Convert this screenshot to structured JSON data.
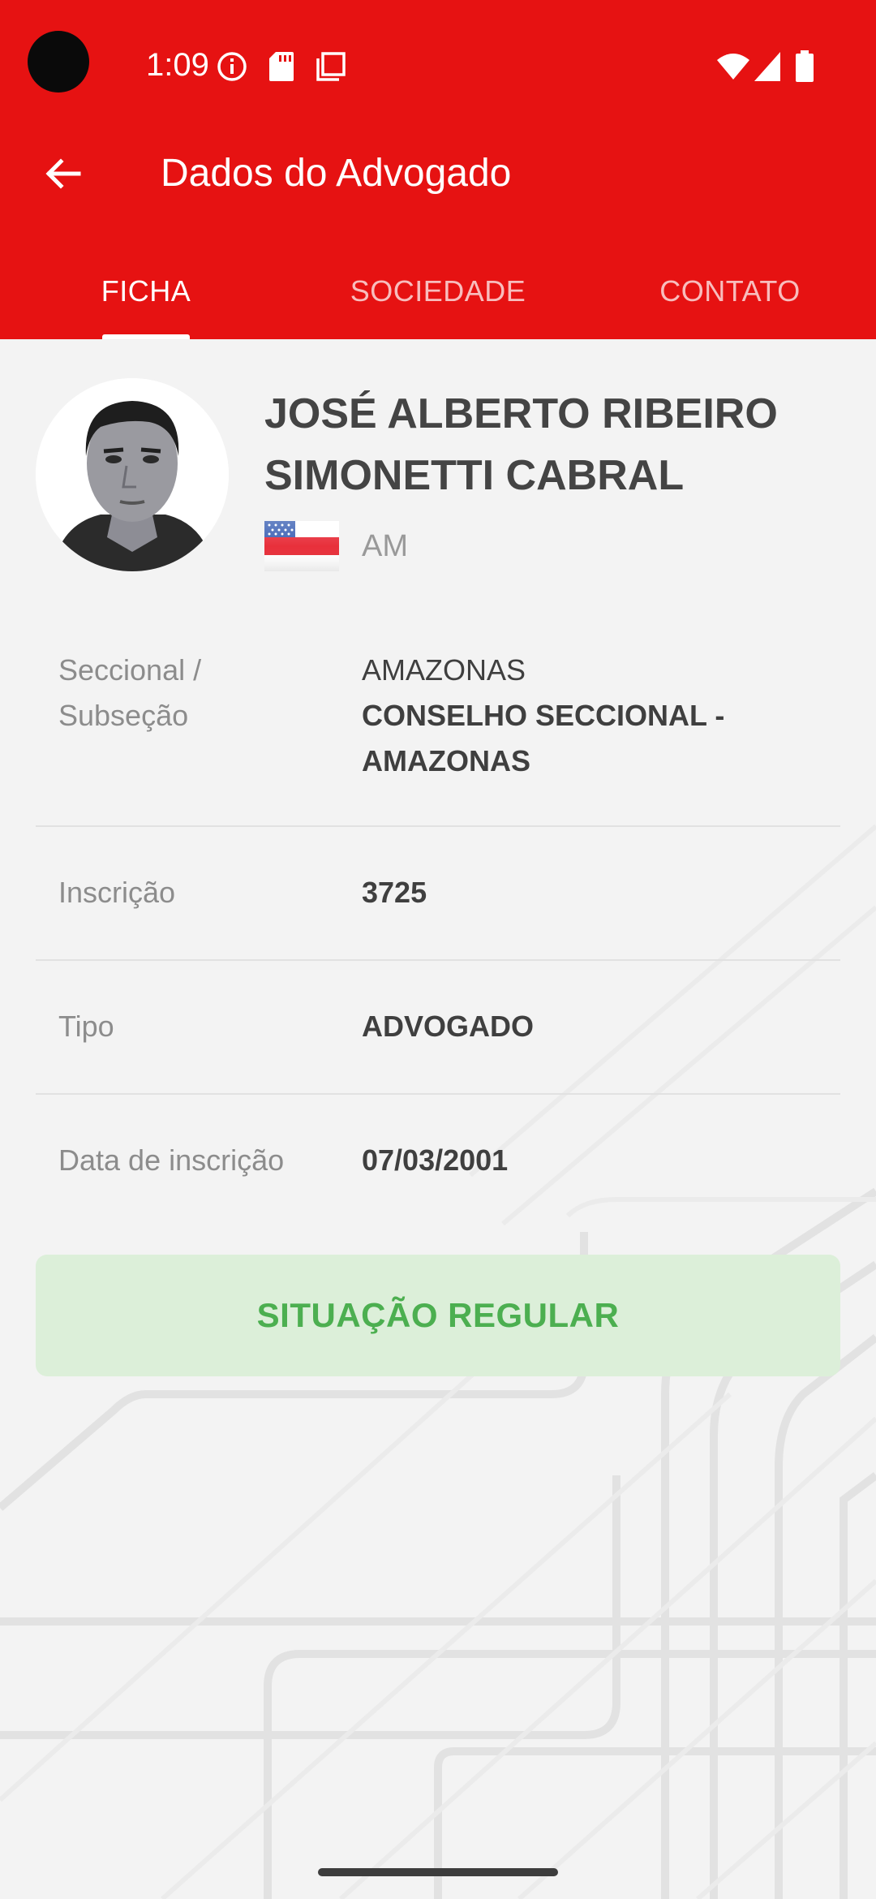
{
  "status_bar": {
    "time": "1:09"
  },
  "header": {
    "title": "Dados do Advogado",
    "tabs": [
      {
        "label": "FICHA",
        "active": true
      },
      {
        "label": "SOCIEDADE",
        "active": false
      },
      {
        "label": "CONTATO",
        "active": false
      }
    ]
  },
  "profile": {
    "name_line1": "JOSÉ ALBERTO RIBEIRO",
    "name_line2": "SIMONETTI CABRAL",
    "state": "AM"
  },
  "fields": {
    "seccional": {
      "label_line1": "Seccional /",
      "label_line2": "Subseção",
      "value_line1": "AMAZONAS",
      "value_line2": "CONSELHO SECCIONAL -",
      "value_line3": "AMAZONAS"
    },
    "inscricao": {
      "label": "Inscrição",
      "value": "3725"
    },
    "tipo": {
      "label": "Tipo",
      "value": "ADVOGADO"
    },
    "data_inscricao": {
      "label": "Data de inscrição",
      "value": "07/03/2001"
    }
  },
  "status": {
    "text": "SITUAÇÃO REGULAR"
  },
  "colors": {
    "primary": "#e61212",
    "status_bg": "#dcefd9",
    "status_text": "#4caf50"
  }
}
